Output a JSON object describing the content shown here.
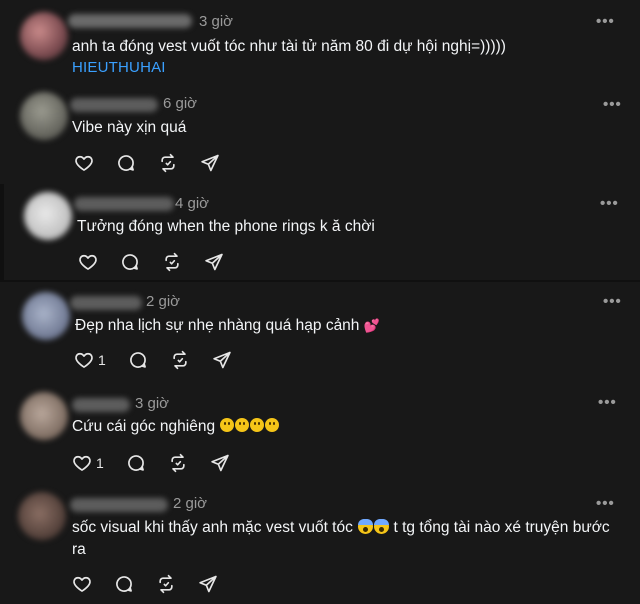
{
  "posts": [
    {
      "time": "3 giờ",
      "text": "anh ta đóng vest vuốt tóc như tài tử năm 80 đi dự hội nghị=)))))",
      "tag": "HIEUTHUHAI",
      "more": "•••"
    },
    {
      "time": "6 giờ",
      "text": "Vibe này xịn quá",
      "more": "•••",
      "likes": ""
    },
    {
      "time": "4 giờ",
      "text": "Tưởng đóng when the phone rings k ă chời",
      "more": "•••",
      "likes": ""
    },
    {
      "time": "2 giờ",
      "text": "Đẹp nha lịch sự nhẹ nhàng quá hạp cảnh",
      "emoji": "💕",
      "more": "•••",
      "likes": "1"
    },
    {
      "time": "3 giờ",
      "text": "Cứu cái góc nghiêng",
      "more": "•••",
      "likes": "1"
    },
    {
      "time": "2 giờ",
      "text_before": "sốc visual khi thấy anh mặc vest vuốt tóc",
      "text_after": "t tg tổng tài nào xé truyện bước",
      "text_line2": "ra",
      "more": "•••",
      "likes": ""
    }
  ],
  "colors": {
    "background": "#101010",
    "text": "#f3f5f7",
    "muted": "#9a9a9a",
    "link": "#3aa0ff"
  },
  "icons": [
    "heart-icon",
    "comment-icon",
    "repost-icon",
    "share-icon",
    "more-icon"
  ]
}
